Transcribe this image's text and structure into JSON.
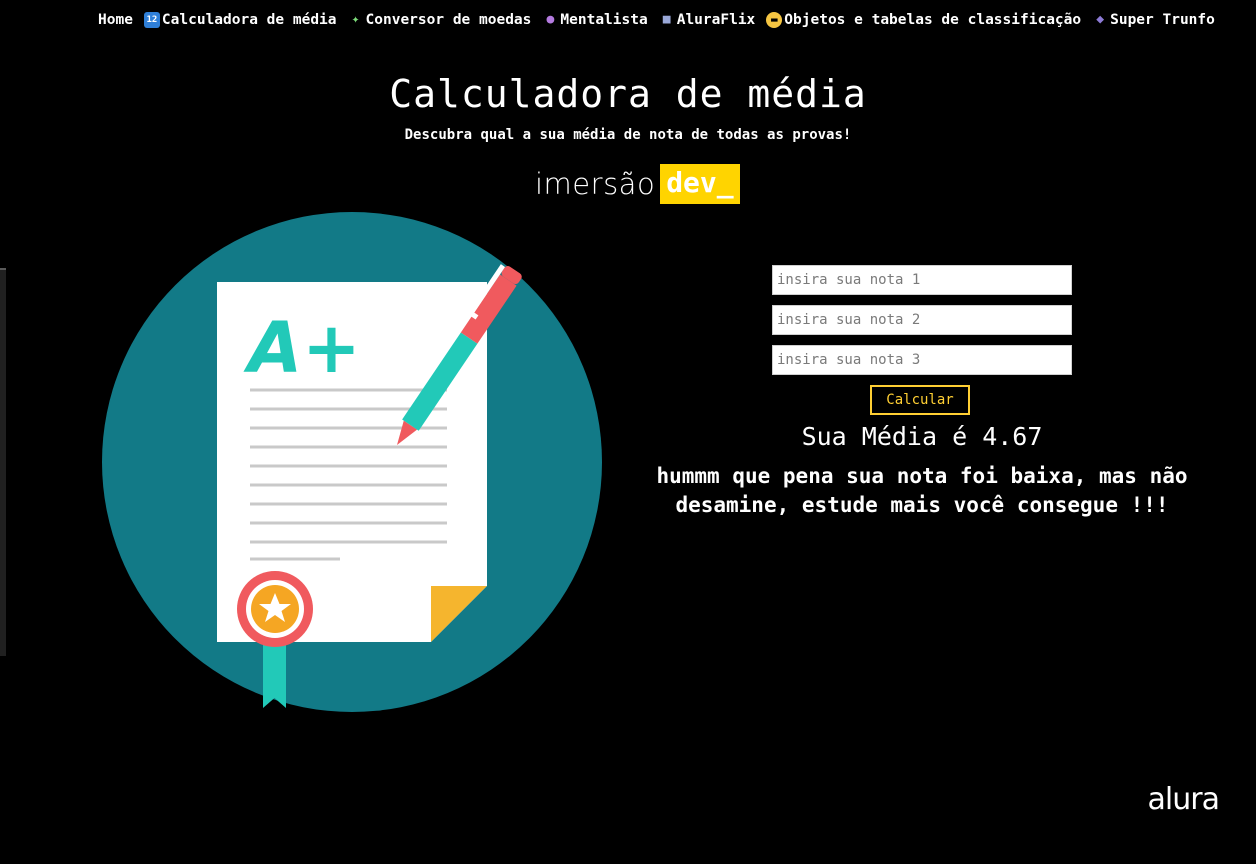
{
  "nav": {
    "items": [
      {
        "label": "Home",
        "icon": ""
      },
      {
        "label": "Calculadora de média",
        "icon": "numbers-icon"
      },
      {
        "label": "Conversor de moedas",
        "icon": "flying-money-icon"
      },
      {
        "label": "Mentalista",
        "icon": "crystal-ball-icon"
      },
      {
        "label": "AluraFlix",
        "icon": "movie-camera-icon"
      },
      {
        "label": "Objetos e tabelas de classificação",
        "icon": "sunglasses-face-icon"
      },
      {
        "label": "Super Trunfo",
        "icon": "game-controller-icon"
      }
    ]
  },
  "header": {
    "title": "Calculadora de média",
    "subtitle": "Descubra qual a sua média de nota de todas as provas!"
  },
  "brand": {
    "word": "imersão",
    "badge": "dev_",
    "badge_color": "#ffd400"
  },
  "illustration": {
    "grade_text": "A+",
    "circle_color": "#127a87",
    "pen_color": "#f05a5e",
    "accent_teal": "#22c9b8",
    "seal_color": "#f5a623"
  },
  "form": {
    "inputs": [
      {
        "placeholder": "insira sua nota 1",
        "value": ""
      },
      {
        "placeholder": "insira sua nota 2",
        "value": ""
      },
      {
        "placeholder": "insira sua nota 3",
        "value": ""
      }
    ],
    "button_label": "Calcular",
    "button_color": "#ffcf33"
  },
  "result": {
    "title": "Sua Média é 4.67",
    "message": "hummm que pena sua nota foi baixa, mas não desamine, estude mais você consegue !!!"
  },
  "footer": {
    "logo": "alura"
  }
}
